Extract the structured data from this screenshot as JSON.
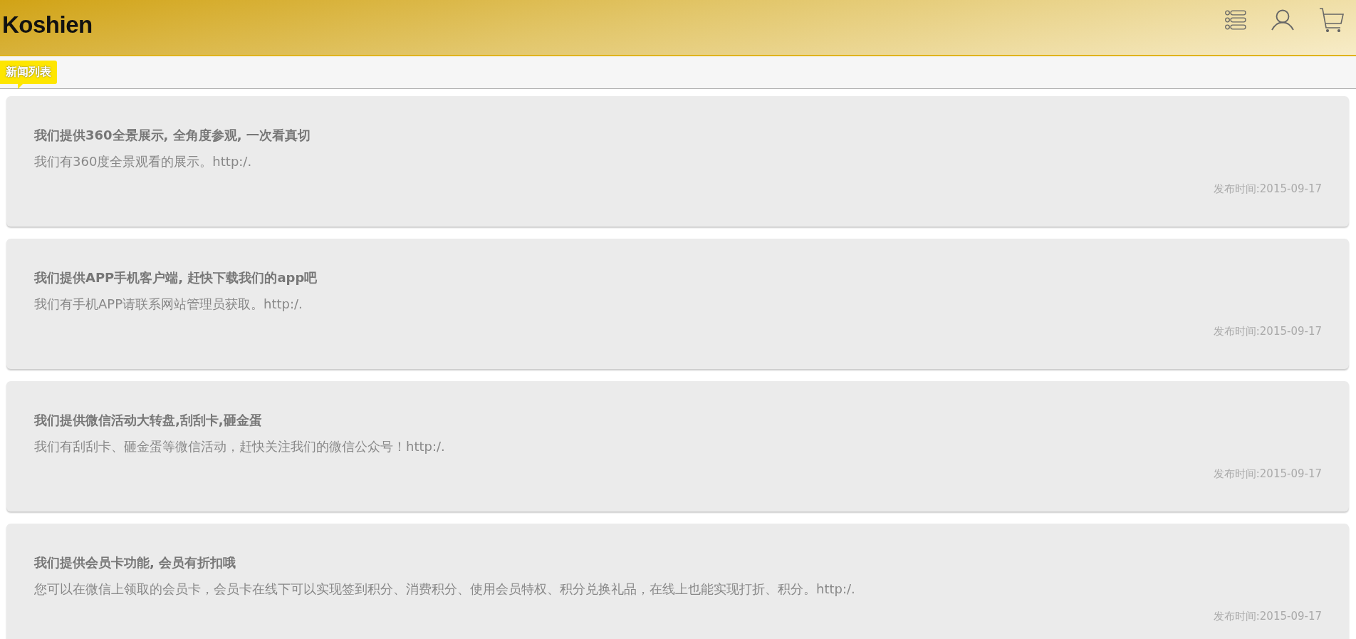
{
  "header": {
    "logo": "Koshien"
  },
  "section": {
    "title": "新闻列表"
  },
  "news": [
    {
      "title": "我们提供360全景展示, 全角度参观, 一次看真切",
      "summary": "我们有360度全景观看的展示。http:/.",
      "date": "发布时间:2015-09-17"
    },
    {
      "title": "我们提供APP手机客户端, 赶快下载我们的app吧",
      "summary": "我们有手机APP请联系网站管理员获取。http:/.",
      "date": "发布时间:2015-09-17"
    },
    {
      "title": "我们提供微信活动大转盘,刮刮卡,砸金蛋",
      "summary": "我们有刮刮卡、砸金蛋等微信活动，赶快关注我们的微信公众号！http:/.",
      "date": "发布时间:2015-09-17"
    },
    {
      "title": "我们提供会员卡功能, 会员有折扣哦",
      "summary": "您可以在微信上领取的会员卡，会员卡在线下可以实现签到积分、消费积分、使用会员特权、积分兑换礼品，在线上也能实现打折、积分。http:/.",
      "date": "发布时间:2015-09-17"
    }
  ]
}
